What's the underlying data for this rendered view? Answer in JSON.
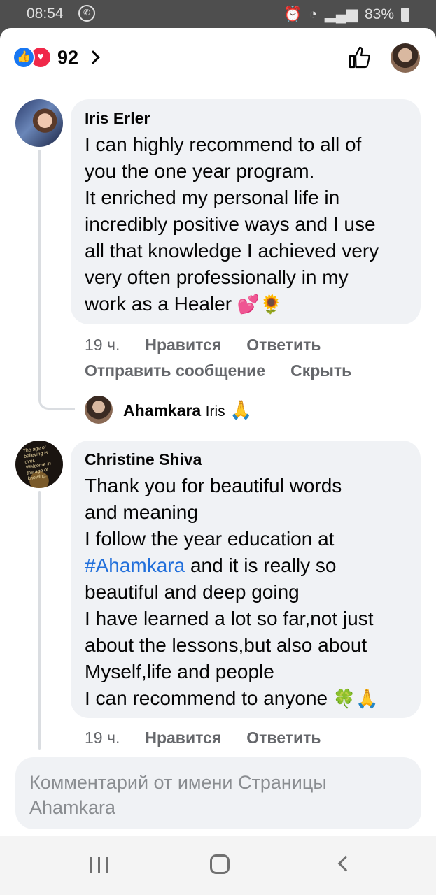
{
  "status_bar": {
    "time": "08:54",
    "battery": "83%"
  },
  "header": {
    "reaction_count": "92"
  },
  "comments": [
    {
      "author": "Iris Erler",
      "text_lines": [
        "I can highly recommend to all of",
        "you the one year program.",
        "It enriched my personal life in",
        "incredibly positive ways and I use",
        "all that knowledge I achieved very",
        "very often professionally in my",
        "work as a Healer"
      ],
      "emoji": "💕🌻",
      "time": "19 ч.",
      "like_label": "Нравится",
      "reply_label": "Ответить",
      "message_label": "Отправить сообщение",
      "hide_label": "Скрыть",
      "reply": {
        "author": "Ahamkara",
        "text": "Iris",
        "emoji": "🙏"
      }
    },
    {
      "author": "Christine Shiva",
      "lines": [
        "Thank you for beautiful words",
        "and meaning",
        "I follow the year education at"
      ],
      "hashtag": "#Ahamkara",
      "hashtag_suffix": " and it is really so",
      "lines_after": [
        "beautiful and deep going",
        "I have learned a lot so far,not just",
        "about the lessons,but also about",
        "Myself,life and people",
        "I can recommend to anyone"
      ],
      "emoji": "🍀🙏",
      "time": "19 ч.",
      "like_label": "Нравится",
      "reply_label": "Ответить",
      "avatar_text": "The age of believing is over. Welcome in the age of knowing."
    }
  ],
  "composer": {
    "placeholder": "Комментарий от имени Страницы Ahamkara"
  }
}
